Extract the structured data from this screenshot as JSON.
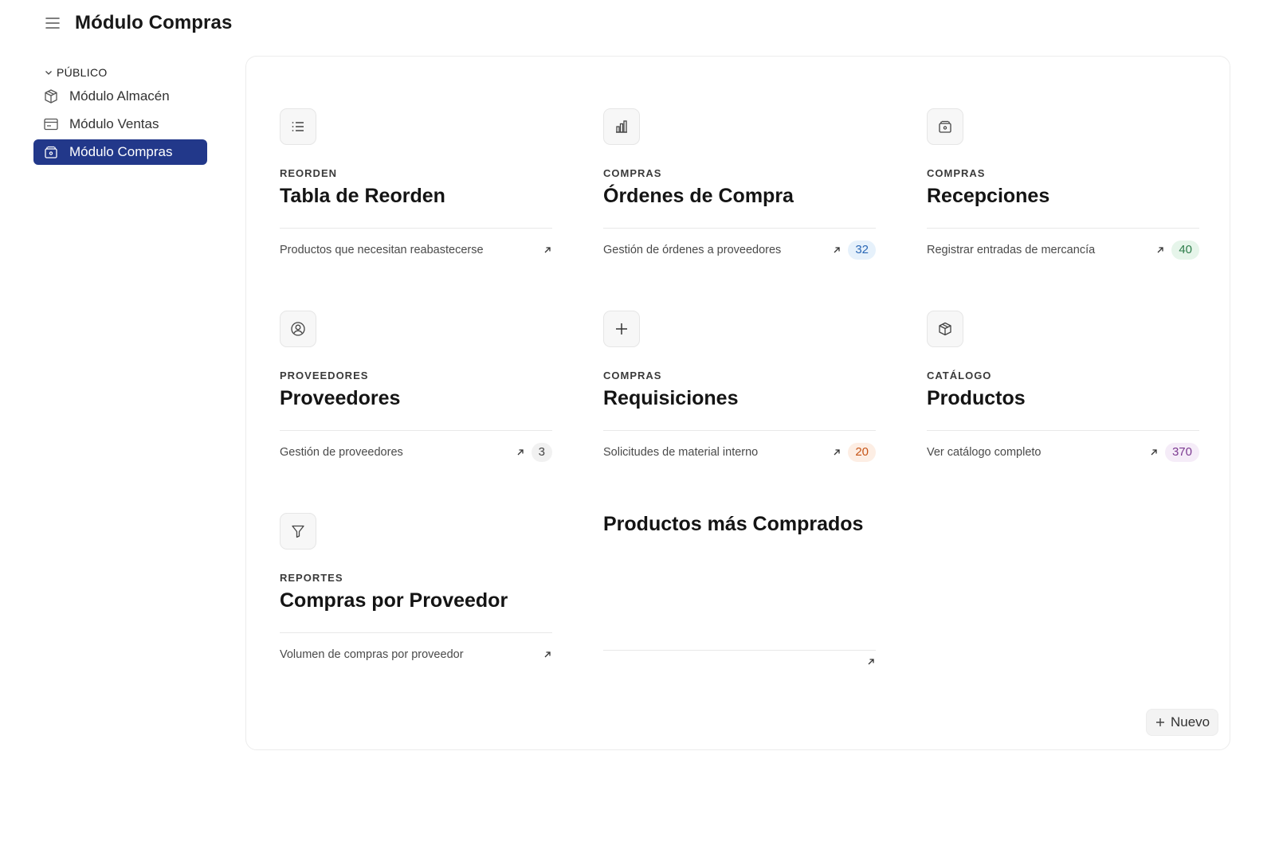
{
  "app": {
    "title": "Módulo Compras",
    "menu_icon": "menu-icon"
  },
  "sidebar": {
    "section": "PÚBLICO",
    "items": [
      {
        "label": "Módulo Almacén",
        "icon": "box-icon",
        "active": false
      },
      {
        "label": "Módulo Ventas",
        "icon": "window-icon",
        "active": false
      },
      {
        "label": "Módulo Compras",
        "icon": "basket-icon",
        "active": true
      }
    ],
    "active_color": "#22388a"
  },
  "tiles": [
    {
      "category": "REORDEN",
      "title": "Tabla de Reorden",
      "description": "Productos que necesitan reabastecerse",
      "icon": "list-icon",
      "count": null
    },
    {
      "category": "COMPRAS",
      "title": "Órdenes de Compra",
      "description": "Gestión de órdenes a proveedores",
      "icon": "bar-chart-icon",
      "count": "32",
      "badge_bg": "#e6f1fb",
      "badge_fg": "#2a67b5"
    },
    {
      "category": "COMPRAS",
      "title": "Recepciones",
      "description": "Registrar entradas de mercancía",
      "icon": "basket-icon",
      "count": "40",
      "badge_bg": "#e6f5ea",
      "badge_fg": "#2e7d4b"
    },
    {
      "category": "PROVEEDORES",
      "title": "Proveedores",
      "description": "Gestión de proveedores",
      "icon": "user-icon",
      "count": "3",
      "badge_bg": "#f1f1f1",
      "badge_fg": "#444444"
    },
    {
      "category": "COMPRAS",
      "title": "Requisiciones",
      "description": "Solicitudes de material interno",
      "icon": "plus-icon",
      "count": "20",
      "badge_bg": "#fdeee4",
      "badge_fg": "#c65417"
    },
    {
      "category": "CATÁLOGO",
      "title": "Productos",
      "description": "Ver catálogo completo",
      "icon": "cube-icon",
      "count": "370",
      "badge_bg": "#f5ecf8",
      "badge_fg": "#7c3a91"
    },
    {
      "category": "REPORTES",
      "title": "Compras por Proveedor",
      "description": "Volumen de compras por proveedor",
      "icon": "filter-icon",
      "count": null
    }
  ],
  "chart_card": {
    "title": "Productos más Comprados"
  },
  "new_button": {
    "label": "Nuevo"
  }
}
